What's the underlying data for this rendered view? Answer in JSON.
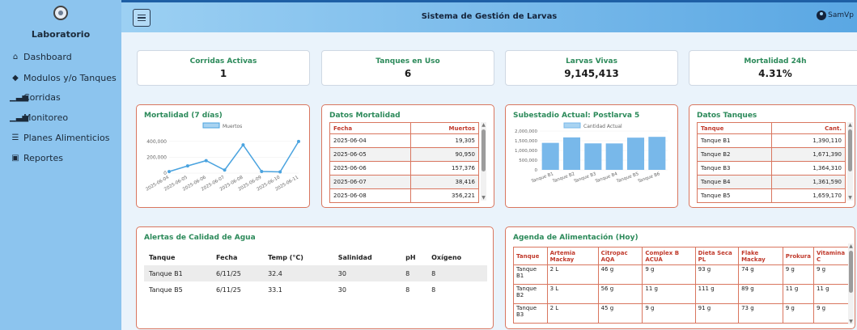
{
  "sidebar": {
    "brand": "Laboratorio",
    "items": [
      {
        "label": "Dashboard",
        "icon": "home-icon"
      },
      {
        "label": "Modulos y/o Tanques",
        "icon": "cube-icon"
      },
      {
        "label": "Corridas",
        "icon": "bar-chart-icon"
      },
      {
        "label": "Monitoreo",
        "icon": "bar-chart-icon"
      },
      {
        "label": "Planes Alimenticios",
        "icon": "list-icon"
      },
      {
        "label": "Reportes",
        "icon": "report-icon"
      }
    ]
  },
  "header": {
    "title": "Sistema de Gestión de Larvas",
    "user": "SamVp"
  },
  "kpis": [
    {
      "label": "Corridas Activas",
      "value": "1"
    },
    {
      "label": "Tanques en Uso",
      "value": "6"
    },
    {
      "label": "Larvas Vivas",
      "value": "9,145,413"
    },
    {
      "label": "Mortalidad 24h",
      "value": "4.31%"
    }
  ],
  "mortalidad_chart": {
    "title": "Mortalidad (7 días)",
    "legend": "Muertos"
  },
  "datos_mortalidad": {
    "title": "Datos Mortalidad",
    "headers": [
      "Fecha",
      "Muertos"
    ],
    "rows": [
      [
        "2025-06-04",
        "19,305"
      ],
      [
        "2025-06-05",
        "90,950"
      ],
      [
        "2025-06-06",
        "157,376"
      ],
      [
        "2025-06-07",
        "38,416"
      ],
      [
        "2025-06-08",
        "356,221"
      ]
    ]
  },
  "subestadio_chart": {
    "title": "Subestadio Actual: Postlarva 5",
    "legend": "Cantidad Actual"
  },
  "datos_tanques": {
    "title": "Datos Tanques",
    "headers": [
      "Tanque",
      "Cant."
    ],
    "rows": [
      [
        "Tanque B1",
        "1,390,110"
      ],
      [
        "Tanque B2",
        "1,671,390"
      ],
      [
        "Tanque B3",
        "1,364,310"
      ],
      [
        "Tanque B4",
        "1,361,590"
      ],
      [
        "Tanque B5",
        "1,659,170"
      ]
    ]
  },
  "alertas": {
    "title": "Alertas de Calidad de Agua",
    "headers": [
      "Tanque",
      "Fecha",
      "Temp (°C)",
      "Salinidad",
      "pH",
      "Oxígeno"
    ],
    "rows": [
      [
        "Tanque B1",
        "6/11/25",
        "32.4",
        "30",
        "8",
        "8"
      ],
      [
        "Tanque B5",
        "6/11/25",
        "33.1",
        "30",
        "8",
        "8"
      ]
    ]
  },
  "agenda": {
    "title": "Agenda de Alimentación (Hoy)",
    "headers": [
      "Tanque",
      "Artemia Mackay",
      "Citropac AQA",
      "Complex B ACUA",
      "Dieta Seca PL",
      "Flake Mackay",
      "Prokura",
      "Vitamina C"
    ],
    "rows": [
      [
        "Tanque B1",
        "2 L",
        "46 g",
        "9 g",
        "93 g",
        "74 g",
        "9 g",
        "9 g"
      ],
      [
        "Tanque B2",
        "3 L",
        "56 g",
        "11 g",
        "111 g",
        "89 g",
        "11 g",
        "11 g"
      ],
      [
        "Tanque B3",
        "2 L",
        "45 g",
        "9 g",
        "91 g",
        "73 g",
        "9 g",
        "9 g"
      ]
    ]
  },
  "chart_data": [
    {
      "type": "line",
      "title": "Mortalidad (7 días)",
      "categories": [
        "2025-06-04",
        "2025-06-05",
        "2025-06-06",
        "2025-06-07",
        "2025-06-08",
        "2025-06-09",
        "2025-06-10",
        "2025-06-11"
      ],
      "series": [
        {
          "name": "Muertos",
          "values": [
            19305,
            90950,
            157376,
            38416,
            356221,
            20000,
            15000,
            400000
          ],
          "color": "#4aa3df"
        }
      ],
      "ylim": [
        0,
        450000
      ],
      "yticks": [
        "0",
        "200,000",
        "400,000"
      ],
      "legend": "top"
    },
    {
      "type": "bar",
      "title": "Subestadio Actual: Postlarva 5",
      "categories": [
        "Tanque B1",
        "Tanque B2",
        "Tanque B3",
        "Tanque B4",
        "Tanque B5",
        "Tanque B6"
      ],
      "series": [
        {
          "name": "Cantidad Actual",
          "values": [
            1390110,
            1671390,
            1364310,
            1361590,
            1659170,
            1700000
          ],
          "color": "#78b8ea"
        }
      ],
      "ylim": [
        0,
        2000000
      ],
      "yticks": [
        "0",
        "500,000",
        "1,000,000",
        "1,500,000",
        "2,000,000"
      ],
      "legend": "top"
    }
  ],
  "colors": {
    "accent": "#2c8a5a",
    "header_red": "#c0392b",
    "border": "#d9765f",
    "sidebar": "#8cc4ee"
  }
}
